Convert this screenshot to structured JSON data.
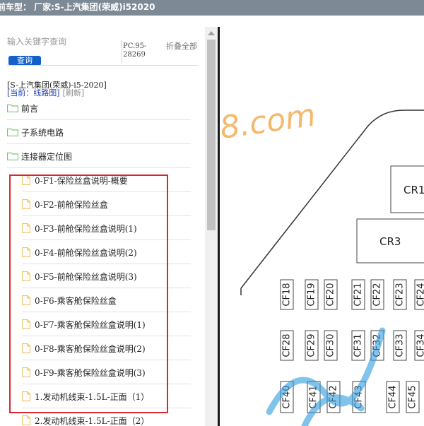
{
  "window": {
    "title": "前车型：  厂家:S-上汽集团(荣威)i52020"
  },
  "search": {
    "placeholder": "输入关键字查询",
    "button_label": "查询",
    "code": "PC.95-28269",
    "collapse_label": "折叠全部"
  },
  "breadcrumb": "[S-上汽集团(荣威)-i5-2020]",
  "current": {
    "label": "[当前：线路图]",
    "refresh": "[刷新]"
  },
  "tree": {
    "folders": [
      {
        "label": "前言"
      },
      {
        "label": "子系统电路"
      },
      {
        "label": "连接器定位图"
      }
    ],
    "files": [
      {
        "label": "0-F1-保险丝盒说明-概要"
      },
      {
        "label": "0-F2-前舱保险丝盒"
      },
      {
        "label": "0-F3-前舱保险丝盒说明(1)"
      },
      {
        "label": "0-F4-前舱保险丝盒说明(2)"
      },
      {
        "label": "0-F5-前舱保险丝盒说明(3)"
      },
      {
        "label": "0-F6-乘客舱保险丝盒"
      },
      {
        "label": "0-F7-乘客舱保险丝盒说明(1)"
      },
      {
        "label": "0-F8-乘客舱保险丝盒说明(2)"
      },
      {
        "label": "0-F9-乘客舱保险丝盒说明(3)"
      },
      {
        "label": "1.发动机线束-1.5L-正面（1）"
      },
      {
        "label": "2.发动机线束-1.5L-正面（2）"
      }
    ]
  },
  "diagram": {
    "watermark": "8.com",
    "relays": [
      "CR1",
      "CR3"
    ],
    "fuses_row1": [
      "CF18",
      "CF19",
      "CF20",
      "CF21",
      "CF22",
      "CF23",
      "CF24"
    ],
    "fuses_row2": [
      "CF28",
      "CF29",
      "CF30",
      "CF31",
      "CF32",
      "CF33",
      "CF34"
    ],
    "fuses_row3": [
      "CF40",
      "CF41",
      "CF42",
      "CF43",
      "CF44",
      "CF45"
    ]
  },
  "colors": {
    "titlebar": "#7d8995",
    "button": "#1560c8",
    "highlight": "#d9282d",
    "folder": "#7cc576",
    "file": "#f0c36d",
    "watermark_orange": "#f2a13c",
    "watermark_blue": "#2f9be0"
  }
}
